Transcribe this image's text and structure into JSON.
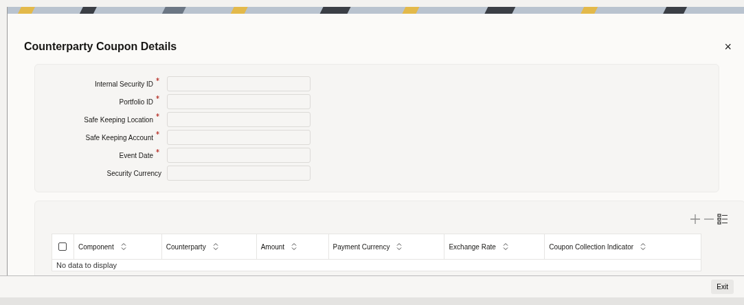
{
  "window": {
    "title": "Counterparty Coupon Details",
    "close": "×"
  },
  "form": {
    "fields": [
      {
        "label": "Internal Security ID",
        "required": true
      },
      {
        "label": "Portfolio ID",
        "required": true
      },
      {
        "label": "Safe Keeping Location",
        "required": true
      },
      {
        "label": "Safe Keeping Account",
        "required": true
      },
      {
        "label": "Event Date",
        "required": true
      },
      {
        "label": "Security Currency",
        "required": false
      }
    ]
  },
  "table": {
    "select_all": {
      "checked": false
    },
    "columns": [
      "Component",
      "Counterparty",
      "Amount",
      "Payment Currency",
      "Exchange Rate",
      "Coupon Collection Indicator"
    ],
    "empty_message": "No data to display"
  },
  "footer": {
    "buttons": [
      "Exit"
    ]
  }
}
